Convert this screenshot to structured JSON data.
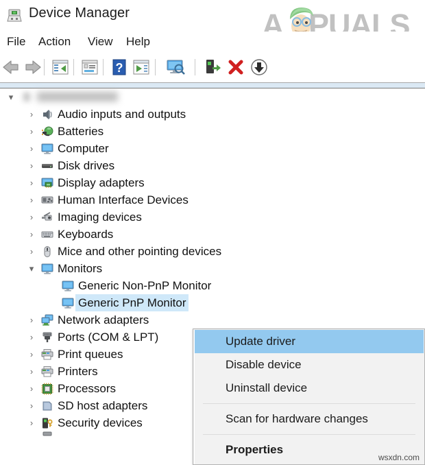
{
  "window": {
    "title": "Device Manager",
    "icon": "device-manager-icon"
  },
  "branding": {
    "logo_text_a": "A",
    "logo_text_rest": "PUALS",
    "logo_color": "#bcbcbc",
    "watermark": "wsxdn.com"
  },
  "menubar": {
    "items": [
      {
        "label": "File"
      },
      {
        "label": "Action"
      },
      {
        "label": "View"
      },
      {
        "label": "Help"
      }
    ]
  },
  "toolbar": {
    "buttons": [
      {
        "name": "back-icon",
        "tip": "Back"
      },
      {
        "name": "forward-icon",
        "tip": "Forward"
      },
      {
        "name": "show-hide-tree-icon",
        "tip": "Show/Hide console tree"
      },
      {
        "name": "properties-icon",
        "tip": "Properties"
      },
      {
        "name": "help-icon",
        "tip": "Help"
      },
      {
        "name": "update-driver-icon",
        "tip": "Update driver"
      },
      {
        "name": "scan-hardware-icon",
        "tip": "Scan for hardware changes"
      },
      {
        "name": "enable-device-icon",
        "tip": "Enable device"
      },
      {
        "name": "uninstall-device-icon",
        "tip": "Uninstall device"
      },
      {
        "name": "disable-device-icon",
        "tip": "Disable device"
      }
    ]
  },
  "tree": {
    "root": {
      "label": "",
      "redacted": true,
      "expanded": true,
      "icon": "computer-node-icon"
    },
    "items": [
      {
        "label": "Audio inputs and outputs",
        "icon": "speaker-icon",
        "level": 1,
        "expandable": true,
        "expanded": false,
        "selected": false
      },
      {
        "label": "Batteries",
        "icon": "battery-icon",
        "level": 1,
        "expandable": true,
        "expanded": false,
        "selected": false
      },
      {
        "label": "Computer",
        "icon": "monitor-icon",
        "level": 1,
        "expandable": true,
        "expanded": false,
        "selected": false
      },
      {
        "label": "Disk drives",
        "icon": "disk-drive-icon",
        "level": 1,
        "expandable": true,
        "expanded": false,
        "selected": false
      },
      {
        "label": "Display adapters",
        "icon": "display-adapter-icon",
        "level": 1,
        "expandable": true,
        "expanded": false,
        "selected": false
      },
      {
        "label": "Human Interface Devices",
        "icon": "hid-icon",
        "level": 1,
        "expandable": true,
        "expanded": false,
        "selected": false
      },
      {
        "label": "Imaging devices",
        "icon": "imaging-icon",
        "level": 1,
        "expandable": true,
        "expanded": false,
        "selected": false
      },
      {
        "label": "Keyboards",
        "icon": "keyboard-icon",
        "level": 1,
        "expandable": true,
        "expanded": false,
        "selected": false
      },
      {
        "label": "Mice and other pointing devices",
        "icon": "mouse-icon",
        "level": 1,
        "expandable": true,
        "expanded": false,
        "selected": false
      },
      {
        "label": "Monitors",
        "icon": "monitor-icon",
        "level": 1,
        "expandable": true,
        "expanded": true,
        "selected": false
      },
      {
        "label": "Generic Non-PnP Monitor",
        "icon": "monitor-icon",
        "level": 2,
        "expandable": false,
        "expanded": false,
        "selected": false
      },
      {
        "label": "Generic PnP Monitor",
        "icon": "monitor-icon",
        "level": 2,
        "expandable": false,
        "expanded": false,
        "selected": true
      },
      {
        "label": "Network adapters",
        "icon": "network-adapter-icon",
        "level": 1,
        "expandable": true,
        "expanded": false,
        "selected": false
      },
      {
        "label": "Ports (COM & LPT)",
        "icon": "port-icon",
        "level": 1,
        "expandable": true,
        "expanded": false,
        "selected": false
      },
      {
        "label": "Print queues",
        "icon": "printer-icon",
        "level": 1,
        "expandable": true,
        "expanded": false,
        "selected": false
      },
      {
        "label": "Printers",
        "icon": "printer-icon",
        "level": 1,
        "expandable": true,
        "expanded": false,
        "selected": false
      },
      {
        "label": "Processors",
        "icon": "processor-icon",
        "level": 1,
        "expandable": true,
        "expanded": false,
        "selected": false
      },
      {
        "label": "SD host adapters",
        "icon": "sd-host-icon",
        "level": 1,
        "expandable": true,
        "expanded": false,
        "selected": false
      },
      {
        "label": "Security devices",
        "icon": "security-icon",
        "level": 1,
        "expandable": true,
        "expanded": false,
        "selected": false
      }
    ],
    "selection_color": "#cfe8f9"
  },
  "context_menu": {
    "highlight_color": "#93c9ef",
    "items": [
      {
        "label": "Update driver",
        "highlighted": true,
        "bold": false,
        "separator_after": false
      },
      {
        "label": "Disable device",
        "highlighted": false,
        "bold": false,
        "separator_after": false
      },
      {
        "label": "Uninstall device",
        "highlighted": false,
        "bold": false,
        "separator_after": true
      },
      {
        "label": "Scan for hardware changes",
        "highlighted": false,
        "bold": false,
        "separator_after": true
      },
      {
        "label": "Properties",
        "highlighted": false,
        "bold": true,
        "separator_after": false
      }
    ]
  }
}
